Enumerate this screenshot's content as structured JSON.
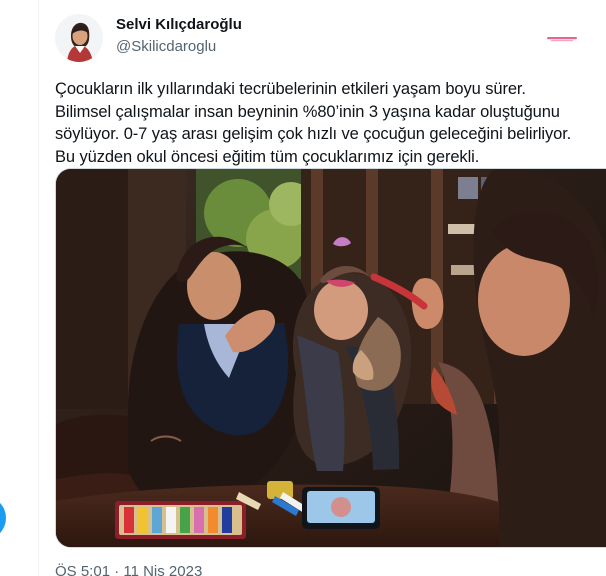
{
  "colors": {
    "text_primary": "#0f1419",
    "text_secondary": "#536471",
    "accent": "#1d9bf0",
    "border": "#eff3f4",
    "watermark": "#e0245e"
  },
  "tweet": {
    "author_name": "Selvi Kılıçdaroğlu",
    "author_handle": "@Skilicdaroglu",
    "text": "Çocukların ilk yıllarındaki tecrübelerinin etkileri yaşam boyu sürer.\nBilimsel çalışmalar insan beyninin %80’inin 3 yaşına kadar oluştuğunu\nsöylüyor. 0-7 yaş arası gelişim çok hızlı ve çocuğun geleceğini belirliyor.\nBu yüzden okul öncesi eğitim tüm çocuklarımız için gerekli.",
    "timestamp": "ÖS 5:01 · 11 Nis 2023",
    "avatar_icon": "profile-avatar",
    "media_icon": "photo"
  }
}
